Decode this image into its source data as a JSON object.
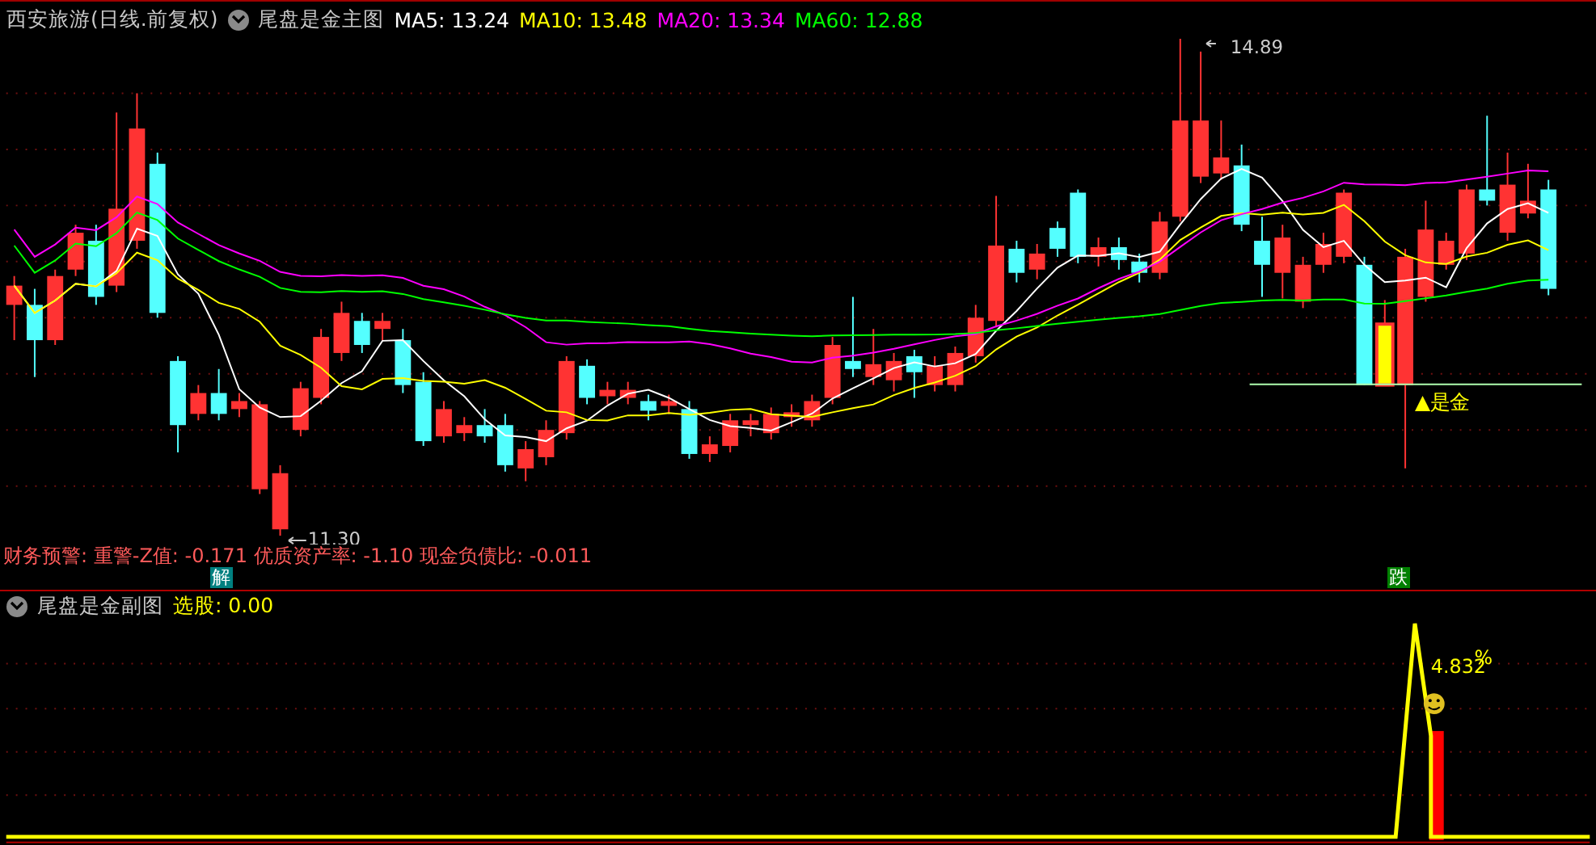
{
  "main_panel": {
    "stock_title": "西安旅游(日线.前复权)",
    "indicator_title": "尾盘是金主图",
    "ma_readings": [
      {
        "label": "MA5: 13.24",
        "color": "#ffffff"
      },
      {
        "label": "MA10: 13.48",
        "color": "#ffff00"
      },
      {
        "label": "MA20: 13.34",
        "color": "#ff00ff"
      },
      {
        "label": "MA60: 12.88",
        "color": "#00ff00"
      }
    ],
    "high_price": "14.89",
    "low_price": "11.30",
    "signal_label": "▲是金",
    "finance_warning": "财务预警: 重警-Z值: -0.171 优质资产率: -1.10 现金负债比: -0.011",
    "event_badges": [
      {
        "text": "解",
        "color": "#008080"
      },
      {
        "text": "跌",
        "color": "#008000"
      }
    ]
  },
  "sub_panel": {
    "indicator_title": "尾盘是金副图",
    "pick_label": "选股: 0.00",
    "peak_value": "4.832",
    "peak_unit": "%"
  }
}
